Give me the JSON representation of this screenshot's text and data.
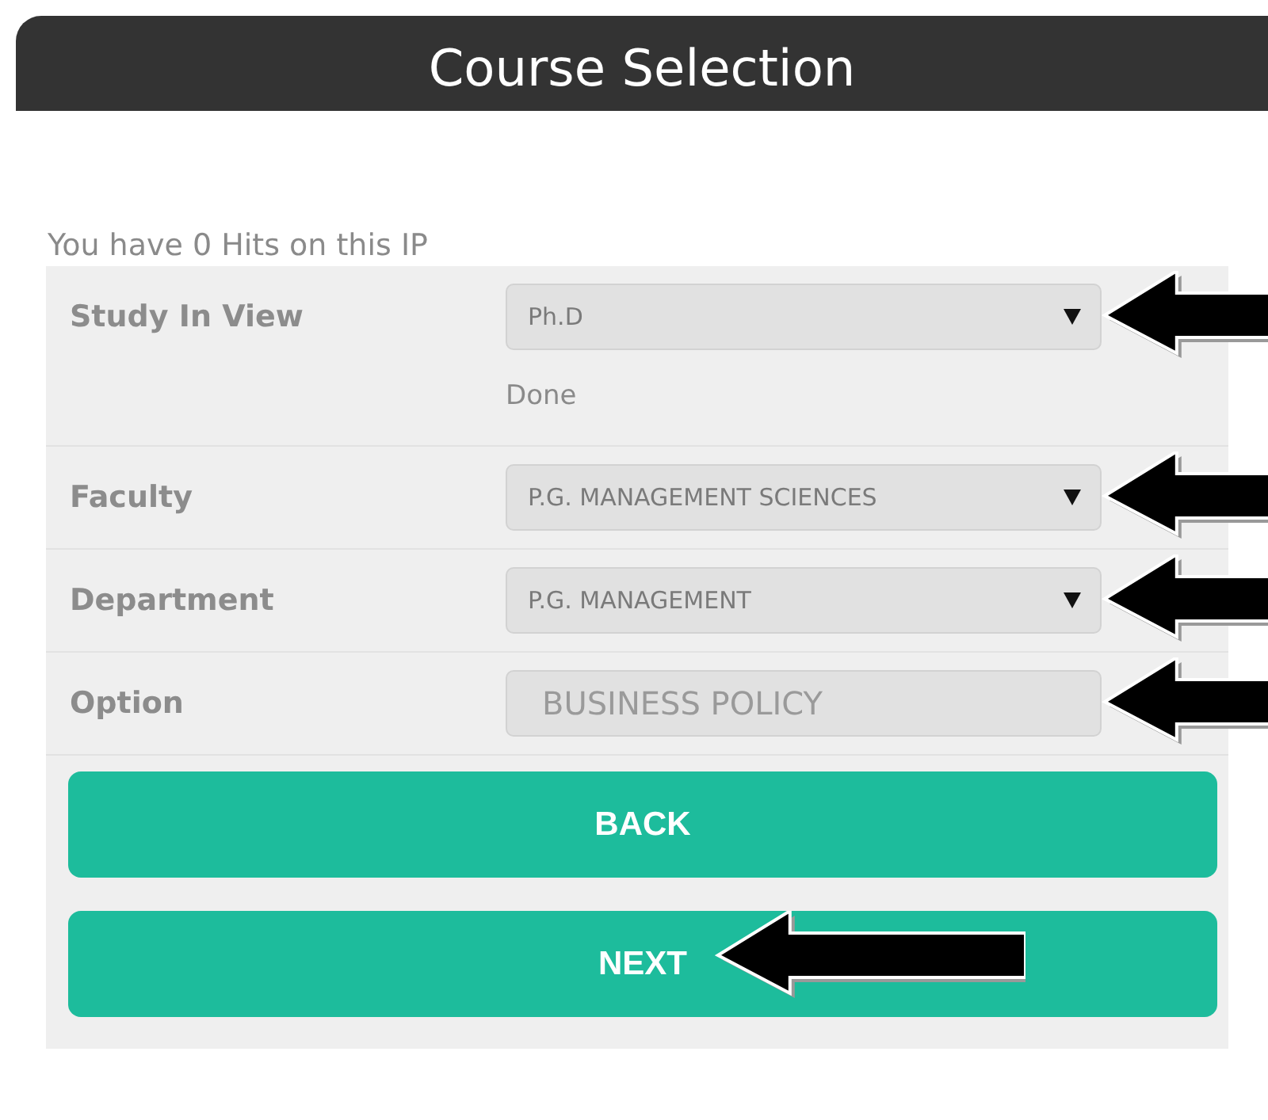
{
  "header": {
    "title": "Course Selection"
  },
  "hits_text": "You have 0 Hits on this IP",
  "fields": [
    {
      "label": "Study In View",
      "kind": "select",
      "value": "Ph.D",
      "disabled": false,
      "note": "Done",
      "arrow": true
    },
    {
      "label": "Faculty",
      "kind": "select",
      "value": "P.G. MANAGEMENT SCIENCES",
      "disabled": false,
      "arrow": true
    },
    {
      "label": "Department",
      "kind": "select",
      "value": "P.G. MANAGEMENT",
      "disabled": false,
      "arrow": true
    },
    {
      "label": "Option",
      "kind": "text",
      "placeholder": "BUSINESS POLICY",
      "disabled": true,
      "arrow": true
    }
  ],
  "buttons": [
    {
      "label": "BACK",
      "arrow": false
    },
    {
      "label": "NEXT",
      "arrow": true
    }
  ]
}
